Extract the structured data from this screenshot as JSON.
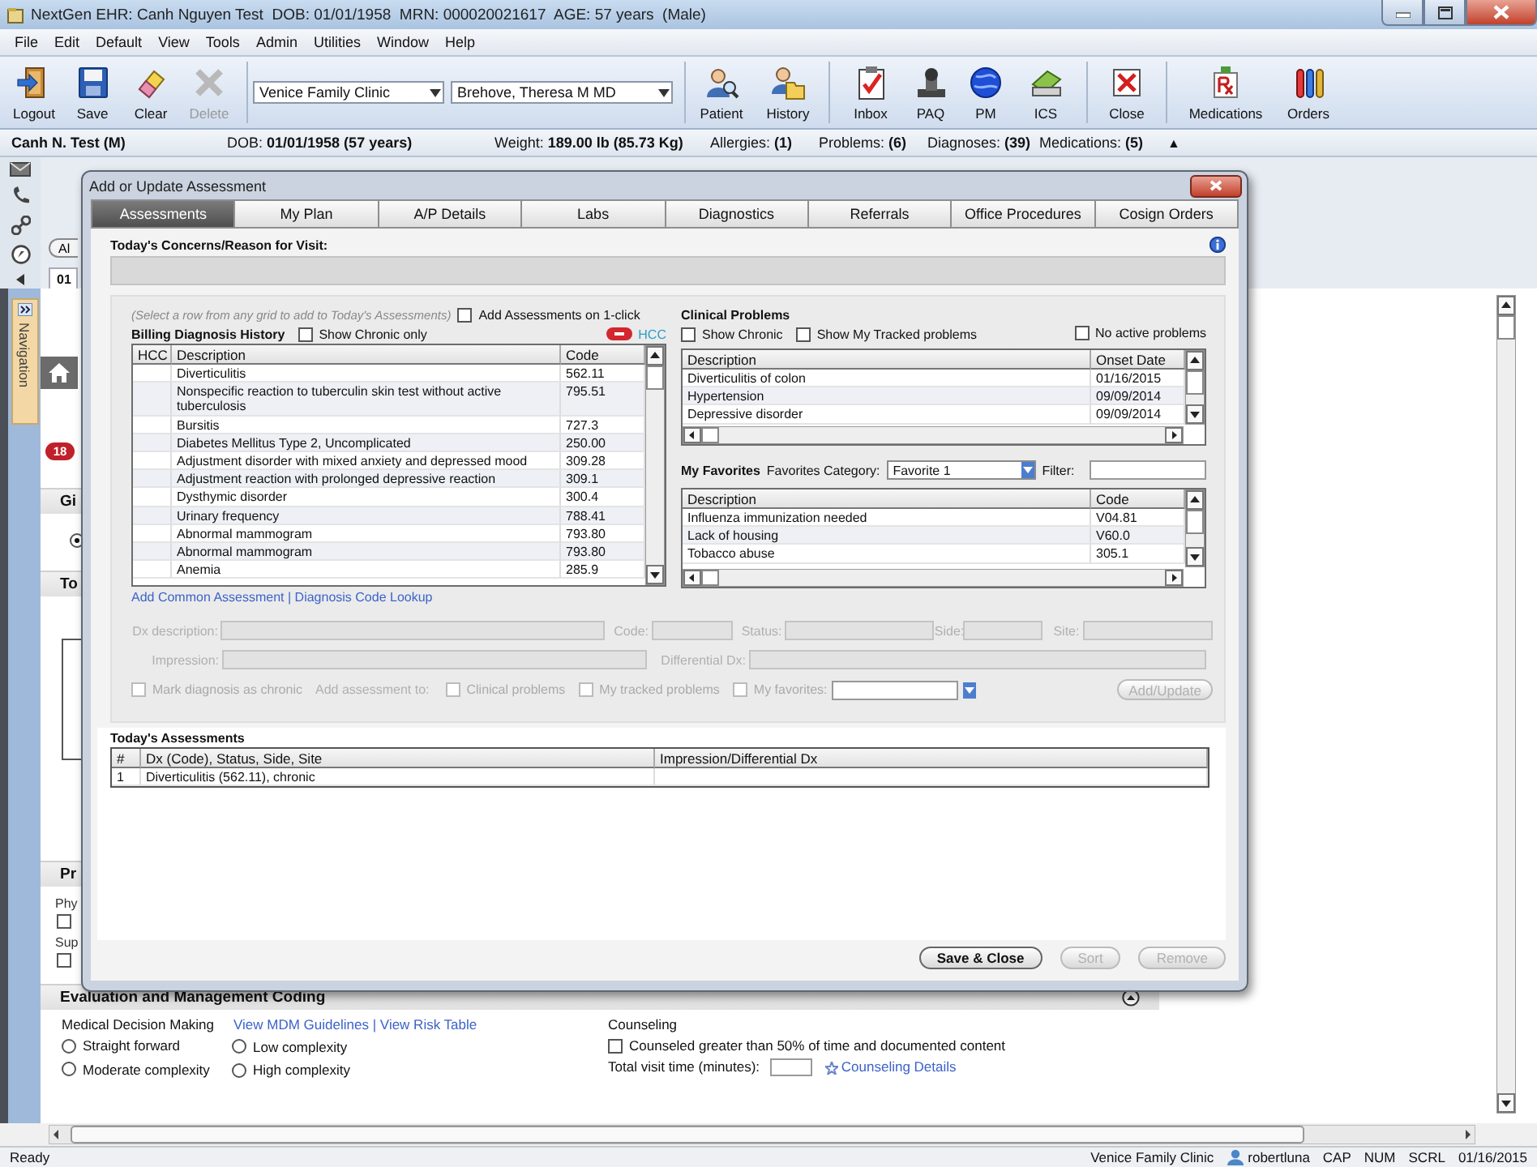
{
  "window": {
    "title": "NextGen EHR: Canh Nguyen Test  DOB: 01/01/1958  MRN: 000020021617  AGE: 57 years  (Male)"
  },
  "menu": [
    "File",
    "Edit",
    "Default",
    "View",
    "Tools",
    "Admin",
    "Utilities",
    "Window",
    "Help"
  ],
  "toolbar": {
    "left_buttons": [
      {
        "kind": "logout",
        "label": "Logout",
        "disabled": false
      },
      {
        "kind": "save",
        "label": "Save",
        "disabled": false
      },
      {
        "kind": "clear",
        "label": "Clear",
        "disabled": false
      },
      {
        "kind": "delete",
        "label": "Delete",
        "disabled": true
      }
    ],
    "location": "Venice Family Clinic",
    "provider": "Brehove, Theresa M MD",
    "right_buttons": [
      {
        "kind": "patient",
        "label": "Patient"
      },
      {
        "kind": "history",
        "label": "History"
      },
      {
        "kind": "inbox",
        "label": "Inbox"
      },
      {
        "kind": "paq",
        "label": "PAQ"
      },
      {
        "kind": "pm",
        "label": "PM"
      },
      {
        "kind": "ics",
        "label": "ICS"
      },
      {
        "kind": "close",
        "label": "Close"
      },
      {
        "kind": "medications",
        "label": "Medications"
      },
      {
        "kind": "orders",
        "label": "Orders"
      }
    ]
  },
  "patient_bar": {
    "name": "Canh N. Test  (M)",
    "items": [
      "DOB: **01/01/1958 (57 years)**",
      "Weight: **189.00 lb (85.73 Kg)**",
      "Allergies: **(1)**",
      "Problems: **(6)**",
      "Diagnoses: **(39)**",
      "Medications: **(5)**"
    ],
    "collapse": "▲"
  },
  "workspace": {
    "button_fragment": "Al",
    "tab_fragment": "01",
    "navigation_label": "Navigation",
    "badge": "18",
    "section_fragments": [
      "Gi",
      "To",
      "Pr"
    ],
    "label_fragments": [
      "Phy",
      "Sup"
    ],
    "option": {
      "selected": true
    },
    "checkboxes": [
      {
        "checked": false
      },
      {
        "checked": false
      }
    ]
  },
  "dialog": {
    "title": "Add or Update Assessment",
    "tabs": [
      {
        "label": "Assessments",
        "selected": true
      },
      {
        "label": "My Plan",
        "selected": false
      },
      {
        "label": "A/P Details",
        "selected": false
      },
      {
        "label": "Labs",
        "selected": false
      },
      {
        "label": "Diagnostics",
        "selected": false
      },
      {
        "label": "Referrals",
        "selected": false
      },
      {
        "label": "Office Procedures",
        "selected": false
      },
      {
        "label": "Cosign Orders",
        "selected": false
      }
    ],
    "concerns_label": "Today's Concerns/Reason for Visit:",
    "hint": "(Select a row from any grid to add to Today's Assessments)",
    "one_click": {
      "label": "Add Assessments on 1-click",
      "checked": false
    },
    "billing": {
      "title": "Billing Diagnosis History",
      "show_chronic": {
        "label": "Show Chronic only",
        "checked": false
      },
      "hcc_link": "HCC",
      "columns": [
        "HCC",
        "Description",
        "Code"
      ],
      "rows": [
        {
          "description": "Diverticulitis",
          "code": "562.11"
        },
        {
          "description": "Nonspecific reaction to tuberculin skin test without active tuberculosis",
          "code": "795.51"
        },
        {
          "description": "Bursitis",
          "code": "727.3"
        },
        {
          "description": "Diabetes Mellitus Type 2, Uncomplicated",
          "code": "250.00"
        },
        {
          "description": "Adjustment disorder with mixed anxiety and depressed mood",
          "code": "309.28"
        },
        {
          "description": "Adjustment reaction with prolonged depressive reaction",
          "code": "309.1"
        },
        {
          "description": "Dysthymic disorder",
          "code": "300.4"
        },
        {
          "description": "Urinary frequency",
          "code": "788.41"
        },
        {
          "description": "Abnormal mammogram",
          "code": "793.80"
        },
        {
          "description": "Abnormal mammogram",
          "code": "793.80"
        },
        {
          "description": "Anemia",
          "code": "285.9"
        }
      ]
    },
    "links": [
      "Add Common Assessment",
      "Diagnosis Code Lookup"
    ],
    "link_separator": "|",
    "form": {
      "disabled": true,
      "fields": [
        {
          "label": "Dx description:"
        },
        {
          "label": "Code:"
        },
        {
          "label": "Status:"
        },
        {
          "label": "Side:"
        },
        {
          "label": "Site:"
        },
        {
          "label": "Impression:"
        },
        {
          "label": "Differential Dx:"
        }
      ],
      "chronic": {
        "label": "Mark diagnosis as chronic",
        "checked": false
      },
      "add_to_label": "Add assessment to:",
      "add_to": [
        {
          "label": "Clinical problems",
          "checked": false
        },
        {
          "label": "My tracked problems",
          "checked": false
        },
        {
          "label": "My favorites:",
          "checked": false
        }
      ],
      "button": "Add/Update"
    },
    "clinical_problems": {
      "title": "Clinical Problems",
      "filters": [
        {
          "label": "Show Chronic",
          "checked": false
        },
        {
          "label": "Show My Tracked problems",
          "checked": false
        },
        {
          "label": "No active problems",
          "checked": false
        }
      ],
      "columns": [
        "Description",
        "Onset Date"
      ],
      "rows": [
        {
          "description": "Diverticulitis of colon",
          "onset": "01/16/2015"
        },
        {
          "description": "Hypertension",
          "onset": "09/09/2014"
        },
        {
          "description": "Depressive disorder",
          "onset": "09/09/2014"
        }
      ]
    },
    "favorites": {
      "title": "My Favorites",
      "category_label": "Favorites Category:",
      "category": "Favorite 1",
      "filter_label": "Filter:",
      "columns": [
        "Description",
        "Code"
      ],
      "rows": [
        {
          "description": "Influenza immunization needed",
          "code": "V04.81"
        },
        {
          "description": "Lack of housing",
          "code": "V60.0"
        },
        {
          "description": "Tobacco abuse",
          "code": "305.1"
        }
      ]
    },
    "todays": {
      "title": "Today's Assessments",
      "columns": [
        "#",
        "Dx (Code), Status, Side, Site",
        "Impression/Differential Dx"
      ],
      "rows": [
        {
          "number": "1",
          "dx": "Diverticulitis (562.11), chronic"
        }
      ]
    },
    "buttons": [
      {
        "label": "Save & Close",
        "disabled": false
      },
      {
        "label": "Sort",
        "disabled": true
      },
      {
        "label": "Remove",
        "disabled": true
      }
    ]
  },
  "em": {
    "title": "Evaluation and Management Coding",
    "mdm_label": "Medical Decision Making",
    "mdm_links": [
      "View MDM Guidelines",
      "View Risk Table"
    ],
    "separator": "|",
    "options": [
      {
        "label": "Straight forward",
        "selected": false
      },
      {
        "label": "Low complexity",
        "selected": false
      },
      {
        "label": "Moderate complexity",
        "selected": false
      },
      {
        "label": "High complexity",
        "selected": false
      }
    ],
    "counseling_title": "Counseling",
    "counseled": {
      "label": "Counseled greater than 50% of time and documented content",
      "checked": false
    },
    "visit_time_label": "Total visit time (minutes):",
    "details_link": "Counseling Details"
  },
  "status_bar": {
    "status": "Ready",
    "location": "Venice Family Clinic",
    "user": "robertluna",
    "indicators": [
      "CAP",
      "NUM",
      "SCRL"
    ],
    "date": "01/16/2015"
  }
}
